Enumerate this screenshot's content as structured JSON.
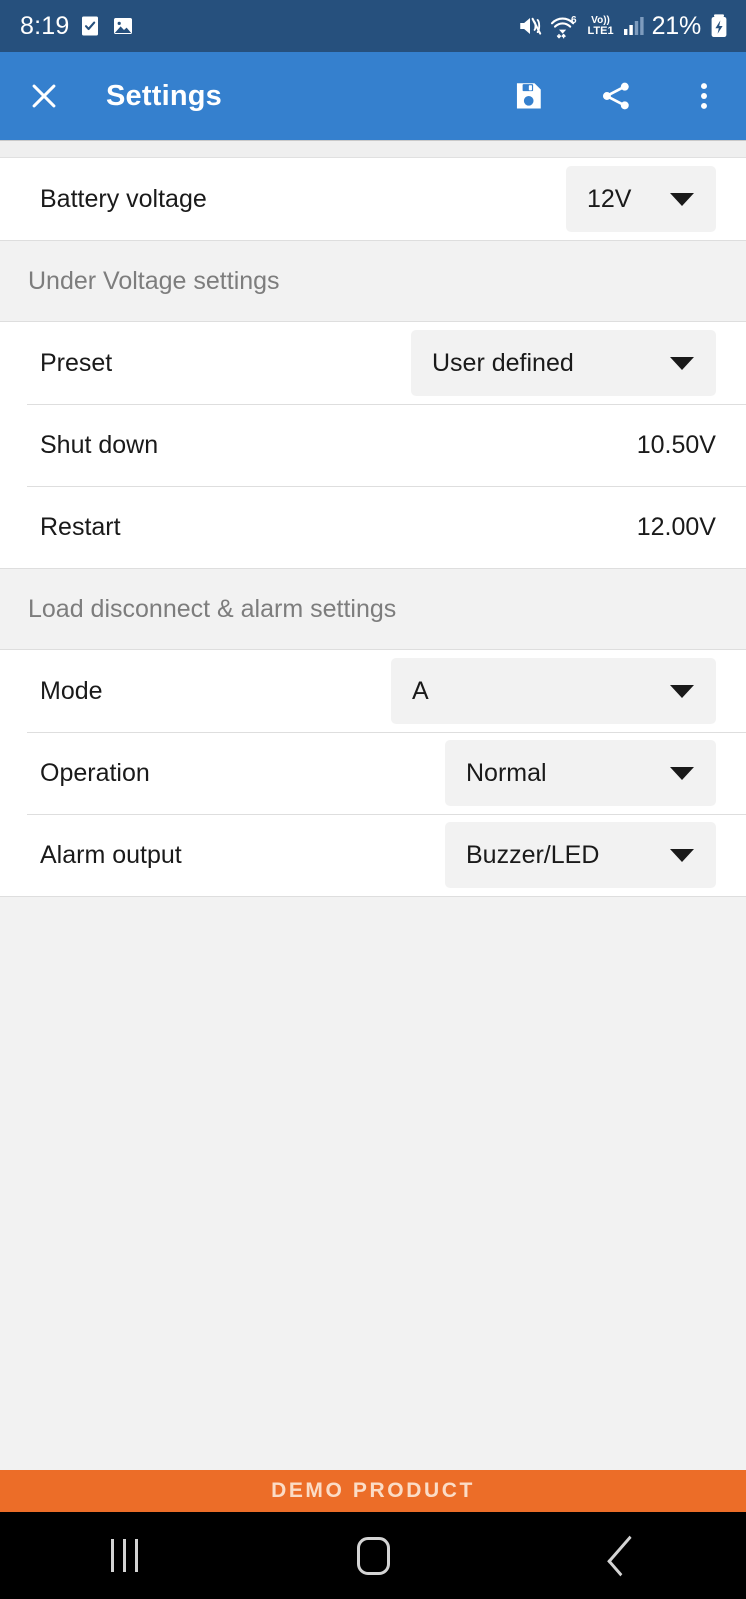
{
  "status_bar": {
    "time": "8:19",
    "icons_left": [
      "checkbox-icon",
      "image-icon"
    ],
    "mute_icon": "mute-icon",
    "wifi_icon": "wifi-icon",
    "wifi_generation": "6",
    "volte_top": "Vo))",
    "volte_bottom": "LTE1",
    "signal_icon": "signal-bars-icon",
    "battery_percent": "21%",
    "battery_icon": "battery-charging-icon",
    "background_color": "#26507D"
  },
  "app_bar": {
    "close_icon": "close-icon",
    "title": "Settings",
    "actions": [
      {
        "name": "save-icon",
        "label": "Save"
      },
      {
        "name": "share-icon",
        "label": "Share"
      },
      {
        "name": "overflow-menu-icon",
        "label": "More options"
      }
    ],
    "background_color": "#3580CE"
  },
  "settings": {
    "battery_voltage": {
      "label": "Battery voltage",
      "value": "12V"
    },
    "under_voltage_header": "Under Voltage settings",
    "preset": {
      "label": "Preset",
      "value": "User defined"
    },
    "shut_down": {
      "label": "Shut down",
      "value": "10.50V"
    },
    "restart": {
      "label": "Restart",
      "value": "12.00V"
    },
    "load_disconnect_header": "Load disconnect & alarm settings",
    "mode": {
      "label": "Mode",
      "value": "A"
    },
    "operation": {
      "label": "Operation",
      "value": "Normal"
    },
    "alarm_output": {
      "label": "Alarm output",
      "value": "Buzzer/LED"
    }
  },
  "demo_banner": {
    "text": "DEMO PRODUCT",
    "background_color": "#EC6D28",
    "text_color": "#FBDCC6"
  },
  "nav_bar": {
    "recents_label": "Recents",
    "home_label": "Home",
    "back_label": "Back"
  }
}
